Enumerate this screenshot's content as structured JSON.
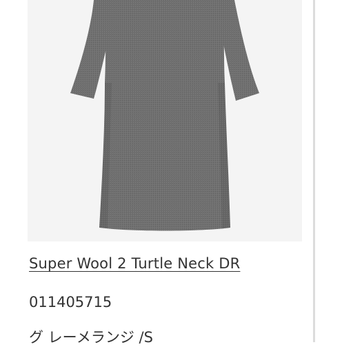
{
  "product": {
    "image_alt": "gray turtle neck long dress",
    "title": "Super Wool 2 Turtle Neck DR",
    "code": "011405715",
    "variant": "グ レーメランジ /S"
  }
}
